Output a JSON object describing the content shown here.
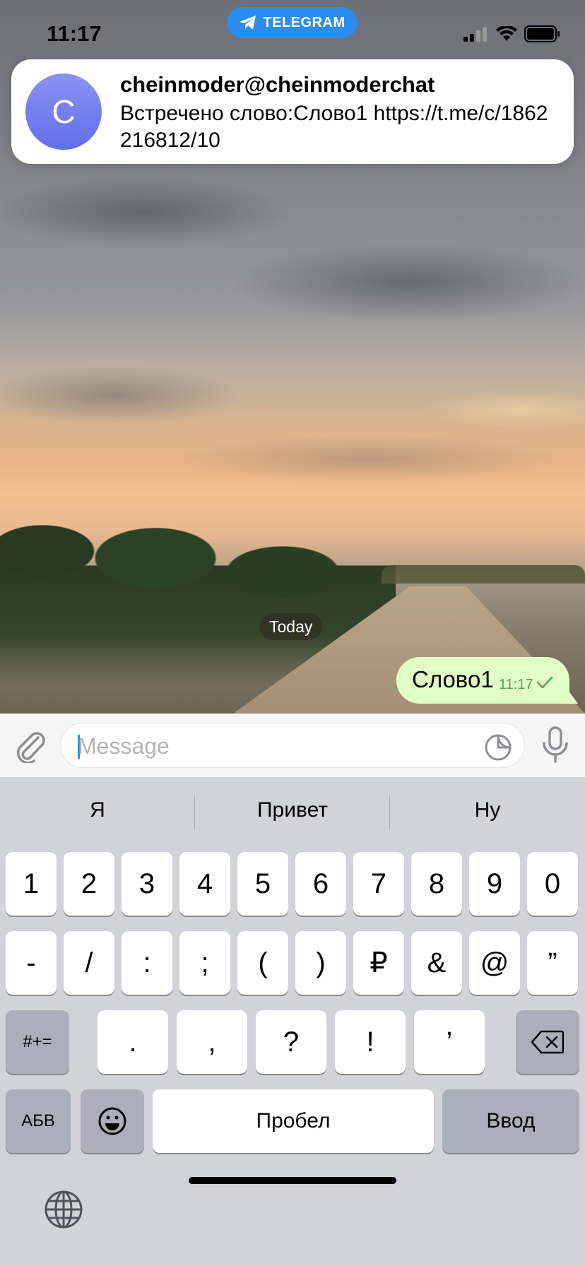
{
  "status_bar": {
    "time": "11:17",
    "pill_label": "TELEGRAM"
  },
  "notification": {
    "avatar_letter": "C",
    "title": "cheinmoder@cheinmoderchat",
    "body": "Встречено слово:Слово1 https://t.me/c/1862216812/10"
  },
  "chat": {
    "date_label": "Today",
    "messages": [
      {
        "text": "Слово1",
        "time": "11:17",
        "status": "sent"
      }
    ]
  },
  "input": {
    "placeholder": "Message",
    "value": ""
  },
  "keyboard": {
    "suggestions": [
      "Я",
      "Привет",
      "Ну"
    ],
    "row1": [
      "1",
      "2",
      "3",
      "4",
      "5",
      "6",
      "7",
      "8",
      "9",
      "0"
    ],
    "row2": [
      "-",
      "/",
      ":",
      ";",
      "(",
      ")",
      "₽",
      "&",
      "@",
      "”"
    ],
    "row3": [
      ".",
      ",",
      "?",
      "!",
      "’"
    ],
    "symbols_toggle": "#+=",
    "alpha_toggle": "АБВ",
    "space_label": "Пробел",
    "return_label": "Ввод"
  },
  "colors": {
    "accent": "#2c8df1",
    "bubble_out": "#e1fec6",
    "check": "#5aa650"
  }
}
